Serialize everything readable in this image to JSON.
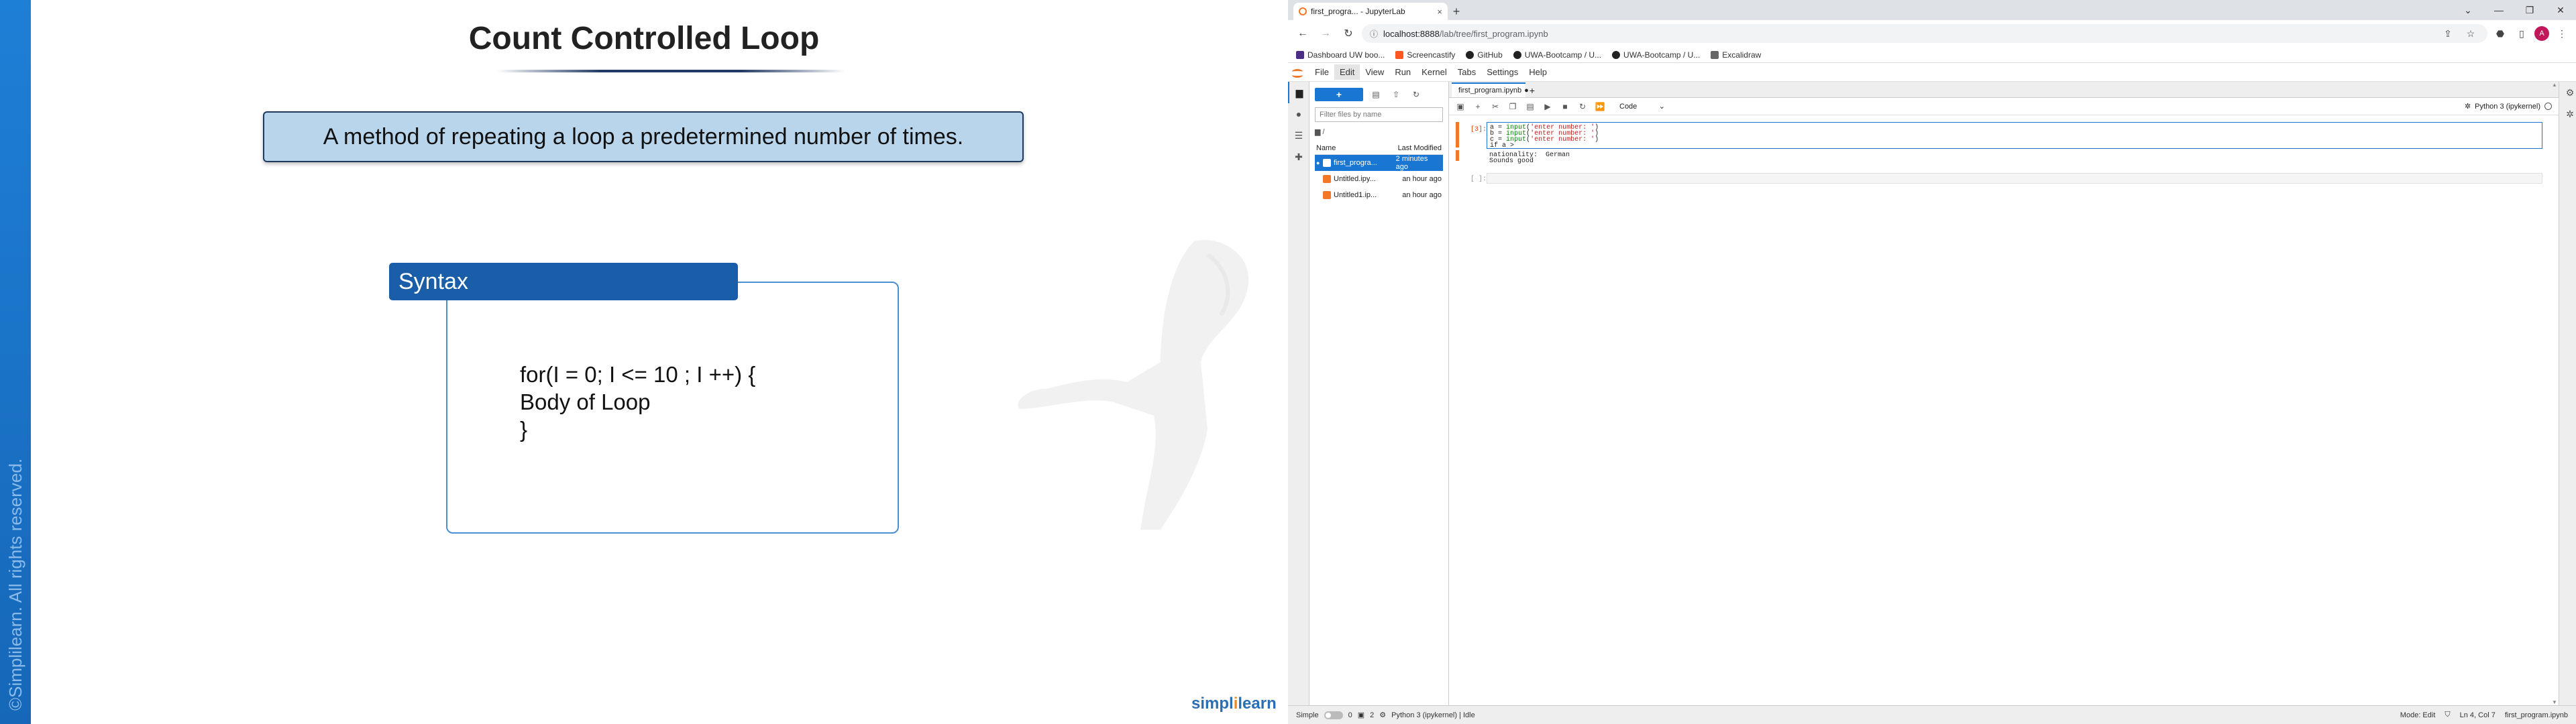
{
  "slide": {
    "title": "Count Controlled Loop",
    "definition": "A method of repeating a loop a predetermined number of times.",
    "syntax_label": "Syntax",
    "code_lines": [
      "for(I = 0; I <= 10 ; I ++) {",
      "Body of Loop",
      "}"
    ],
    "copyright": "©Simplilearn. All rights reserved.",
    "logo_part1": "simpl",
    "logo_part2": "i",
    "logo_part3": "learn"
  },
  "browser": {
    "tab_title": "first_progra... - JupyterLab",
    "tab_close": "×",
    "new_tab": "+",
    "window_controls": [
      "⌄",
      "—",
      "❐",
      "✕"
    ],
    "url_host": "localhost:8888",
    "url_path": "/lab/tree/first_program.ipynb",
    "profile_initial": "A",
    "bookmarks": [
      {
        "label": "Dashboard UW boo...",
        "color": "#4b2e83"
      },
      {
        "label": "Screencastify",
        "color": "#ff5722"
      },
      {
        "label": "GitHub",
        "color": "#222222"
      },
      {
        "label": "UWA-Bootcamp / U...",
        "color": "#222222"
      },
      {
        "label": "UWA-Bootcamp / U...",
        "color": "#222222"
      },
      {
        "label": "Excalidraw",
        "color": "#666666"
      }
    ]
  },
  "jupyter": {
    "menu": [
      "File",
      "Edit",
      "View",
      "Run",
      "Kernel",
      "Tabs",
      "Settings",
      "Help"
    ],
    "active_menu": "Edit",
    "new_button": "+",
    "filter_placeholder": "Filter files by name",
    "path": "/",
    "col_name": "Name",
    "col_modified": "Last Modified",
    "files": [
      {
        "name": "first_progra...",
        "modified": "2 minutes ago",
        "selected": true
      },
      {
        "name": "Untitled.ipy...",
        "modified": "an hour ago",
        "selected": false
      },
      {
        "name": "Untitled1.ip...",
        "modified": "an hour ago",
        "selected": false
      }
    ],
    "doc_tab": "first_program.ipynb",
    "cell_type": "Code",
    "kernel": "Python 3 (ipykernel)",
    "cell1_prompt": "[3]:",
    "cell1_lines": [
      {
        "var": "a",
        "fn": "input",
        "str": "'enter number: '"
      },
      {
        "var": "b",
        "fn": "input",
        "str": "'enter number: '"
      },
      {
        "var": "c",
        "fn": "input",
        "str": "'enter number: '"
      }
    ],
    "cell1_last": "if a >",
    "output_lines": [
      "nationality:  German",
      "Sounds good"
    ],
    "cell2_prompt": "[ ]:",
    "status": {
      "mode_label": "Simple",
      "count1": "0",
      "count2": "2",
      "kernel_status": "Python 3 (ipykernel) | Idle",
      "mode": "Mode: Edit",
      "position": "Ln 4, Col 7",
      "file": "first_program.ipynb"
    }
  }
}
